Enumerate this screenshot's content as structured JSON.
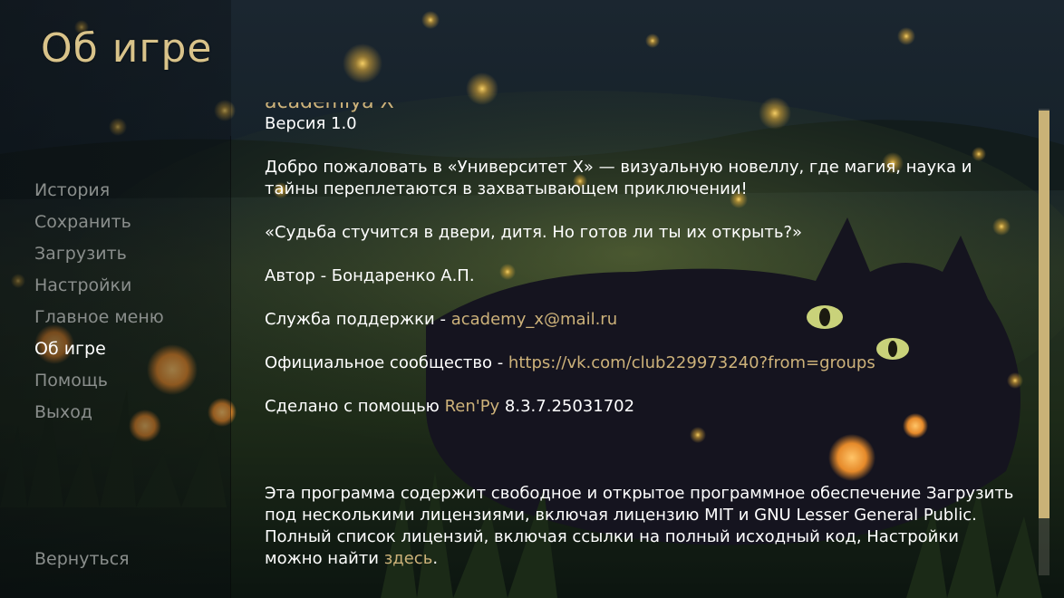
{
  "screen": {
    "title": "Об игре"
  },
  "nav": {
    "items": [
      {
        "label": "История"
      },
      {
        "label": "Сохранить"
      },
      {
        "label": "Загрузить"
      },
      {
        "label": "Настройки"
      },
      {
        "label": "Главное меню"
      },
      {
        "label": "Об игре",
        "active": true
      },
      {
        "label": "Помощь"
      },
      {
        "label": "Выход"
      }
    ],
    "back_label": "Вернуться"
  },
  "about": {
    "game_name": "academiya X",
    "version": "Версия 1.0",
    "welcome": "Добро пожаловать в «Университет X» — визуальную новеллу, где магия, наука и тайны переплетаются в захватывающем приключении!",
    "quote": "«Судьба стучится в двери, дитя. Но готов ли ты их открыть?»",
    "author": "Автор - Бондаренко А.П.",
    "support_label": "Служба поддержки - ",
    "support_email": "academy_x@mail.ru",
    "community_label": "Официальное сообщество - ",
    "community_url": "https://vk.com/club229973240?from=groups",
    "made_with_prefix": "Сделано с помощью ",
    "engine_name": "Ren'Py",
    "engine_version": " 8.3.7.25031702",
    "license_text": "Эта программа содержит свободное и открытое программное обеспечение Загрузить под несколькими лицензиями, включая лицензию MIT и GNU Lesser General Public. Полный список лицензий, включая ссылки на полный исходный код, Настройки можно найти ",
    "license_link": "здесь",
    "license_end": "."
  },
  "scrollbar": {
    "position": 0.03
  },
  "colors": {
    "accent": "#cdb27a",
    "title": "#d9c38a",
    "nav_idle": "#8a8e8c",
    "nav_active": "#ffffff",
    "scroll_thumb": "#c9b277"
  }
}
